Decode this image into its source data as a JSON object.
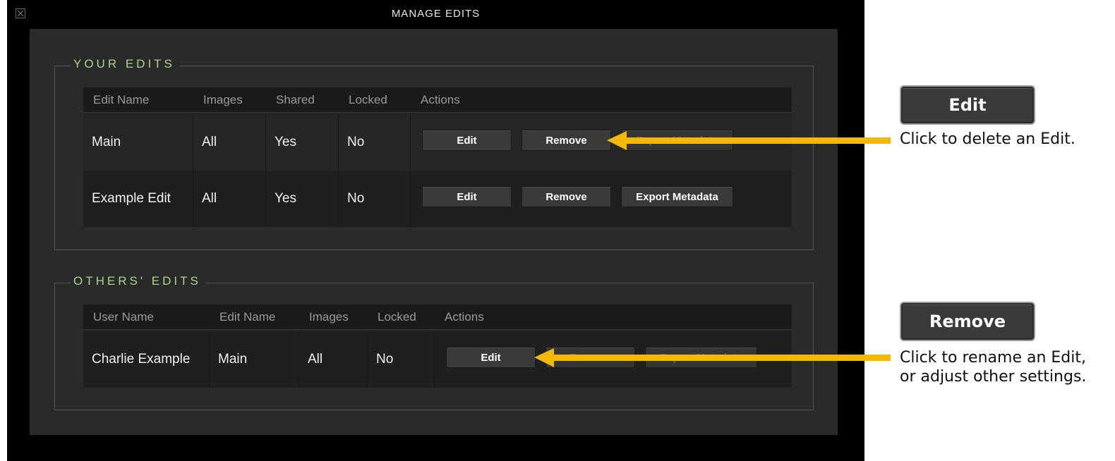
{
  "window": {
    "title": "MANAGE EDITS"
  },
  "your_edits": {
    "label": "YOUR EDITS",
    "headers": [
      "Edit Name",
      "Images",
      "Shared",
      "Locked",
      "Actions"
    ],
    "rows": [
      {
        "name": "Main",
        "images": "All",
        "shared": "Yes",
        "locked": "No",
        "actions": [
          "Edit",
          "Remove",
          "Export Metadata"
        ]
      },
      {
        "name": "Example Edit",
        "images": "All",
        "shared": "Yes",
        "locked": "No",
        "actions": [
          "Edit",
          "Remove",
          "Export Metadata"
        ]
      }
    ]
  },
  "others_edits": {
    "label": "OTHERS' EDITS",
    "headers": [
      "User Name",
      "Edit Name",
      "Images",
      "Locked",
      "Actions"
    ],
    "rows": [
      {
        "user": "Charlie Example",
        "name": "Main",
        "images": "All",
        "locked": "No",
        "actions": [
          "Edit",
          "Remove",
          "Export Metadata"
        ]
      }
    ]
  },
  "callouts": [
    {
      "button": "Edit",
      "text": "Click to delete an Edit."
    },
    {
      "button": "Remove",
      "text": "Click to rename an Edit, or adjust other settings."
    }
  ],
  "colors": {
    "arrow": "#f5b800",
    "group_label": "#a8d88a",
    "window_bg": "#000000",
    "panel_bg": "#2a2a2a"
  }
}
